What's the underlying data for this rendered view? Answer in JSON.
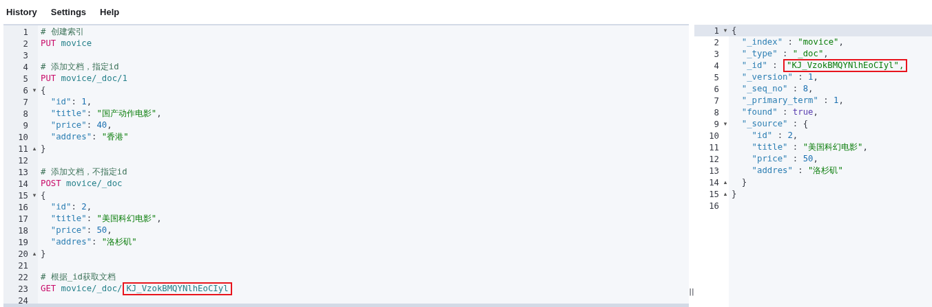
{
  "menu": [
    "History",
    "Settings",
    "Help"
  ],
  "request_editor": {
    "lines": [
      {
        "number": "1",
        "tokens": [
          {
            "text": "# 创建索引",
            "kind": "comment"
          }
        ]
      },
      {
        "number": "2",
        "tokens": [
          {
            "text": "PUT",
            "kind": "method"
          },
          {
            "text": " movice",
            "kind": "path"
          }
        ]
      },
      {
        "number": "3"
      },
      {
        "number": "4",
        "tokens": [
          {
            "text": "# 添加文档，指定id",
            "kind": "comment"
          }
        ]
      },
      {
        "number": "5",
        "tokens": [
          {
            "text": "PUT",
            "kind": "method"
          },
          {
            "text": " movice/_doc/1",
            "kind": "path"
          }
        ]
      },
      {
        "number": "6",
        "fold_marker": "▾",
        "tokens": [
          {
            "text": "{",
            "kind": "punct"
          }
        ]
      },
      {
        "number": "7",
        "tokens": [
          {
            "text": "  \"id\"",
            "kind": "key"
          },
          {
            "text": ": ",
            "kind": "punct"
          },
          {
            "text": "1",
            "kind": "number"
          },
          {
            "text": ",",
            "kind": "punct"
          }
        ]
      },
      {
        "number": "8",
        "tokens": [
          {
            "text": "  \"title\"",
            "kind": "key"
          },
          {
            "text": ": ",
            "kind": "punct"
          },
          {
            "text": "\"国产动作电影\"",
            "kind": "string"
          },
          {
            "text": ",",
            "kind": "punct"
          }
        ]
      },
      {
        "number": "9",
        "tokens": [
          {
            "text": "  \"price\"",
            "kind": "key"
          },
          {
            "text": ": ",
            "kind": "punct"
          },
          {
            "text": "40",
            "kind": "number"
          },
          {
            "text": ",",
            "kind": "punct"
          }
        ]
      },
      {
        "number": "10",
        "tokens": [
          {
            "text": "  \"addres\"",
            "kind": "key"
          },
          {
            "text": ": ",
            "kind": "punct"
          },
          {
            "text": "\"香港\"",
            "kind": "string"
          }
        ]
      },
      {
        "number": "11",
        "fold_marker": "▴",
        "tokens": [
          {
            "text": "}",
            "kind": "punct"
          }
        ]
      },
      {
        "number": "12"
      },
      {
        "number": "13",
        "tokens": [
          {
            "text": "# 添加文档，不指定id",
            "kind": "comment"
          }
        ]
      },
      {
        "number": "14",
        "tokens": [
          {
            "text": "POST",
            "kind": "method"
          },
          {
            "text": " movice/_doc",
            "kind": "path"
          }
        ]
      },
      {
        "number": "15",
        "fold_marker": "▾",
        "tokens": [
          {
            "text": "{",
            "kind": "punct"
          }
        ]
      },
      {
        "number": "16",
        "tokens": [
          {
            "text": "  \"id\"",
            "kind": "key"
          },
          {
            "text": ": ",
            "kind": "punct"
          },
          {
            "text": "2",
            "kind": "number"
          },
          {
            "text": ",",
            "kind": "punct"
          }
        ]
      },
      {
        "number": "17",
        "tokens": [
          {
            "text": "  \"title\"",
            "kind": "key"
          },
          {
            "text": ": ",
            "kind": "punct"
          },
          {
            "text": "\"美国科幻电影\"",
            "kind": "string"
          },
          {
            "text": ",",
            "kind": "punct"
          }
        ]
      },
      {
        "number": "18",
        "tokens": [
          {
            "text": "  \"price\"",
            "kind": "key"
          },
          {
            "text": ": ",
            "kind": "punct"
          },
          {
            "text": "50",
            "kind": "number"
          },
          {
            "text": ",",
            "kind": "punct"
          }
        ]
      },
      {
        "number": "19",
        "tokens": [
          {
            "text": "  \"addres\"",
            "kind": "key"
          },
          {
            "text": ": ",
            "kind": "punct"
          },
          {
            "text": "\"洛杉矶\"",
            "kind": "string"
          }
        ]
      },
      {
        "number": "20",
        "fold_marker": "▴",
        "tokens": [
          {
            "text": "}",
            "kind": "punct"
          }
        ]
      },
      {
        "number": "21"
      },
      {
        "number": "22",
        "tokens": [
          {
            "text": "# 根据_id获取文档",
            "kind": "comment"
          }
        ]
      },
      {
        "number": "23",
        "tokens": [
          {
            "text": "GET",
            "kind": "method"
          },
          {
            "text": " movice/_doc/",
            "kind": "path"
          },
          {
            "text": "KJ_VzokBMQYNlhEoCIyl",
            "kind": "path",
            "highlight": true
          }
        ]
      },
      {
        "number": "24"
      }
    ]
  },
  "splitter": {
    "label": "||"
  },
  "response_editor": {
    "lines": [
      {
        "number": "1",
        "fold_marker": "▾",
        "active": true,
        "tokens": [
          {
            "text": "{",
            "kind": "punct"
          }
        ]
      },
      {
        "number": "2",
        "tokens": [
          {
            "text": "  \"_index\"",
            "kind": "key"
          },
          {
            "text": " : ",
            "kind": "punct"
          },
          {
            "text": "\"movice\"",
            "kind": "string"
          },
          {
            "text": ",",
            "kind": "punct"
          }
        ]
      },
      {
        "number": "3",
        "tokens": [
          {
            "text": "  \"_type\"",
            "kind": "key"
          },
          {
            "text": " : ",
            "kind": "punct"
          },
          {
            "text": "\"_doc\"",
            "kind": "string"
          },
          {
            "text": ",",
            "kind": "punct"
          }
        ]
      },
      {
        "number": "4",
        "tokens": [
          {
            "text": "  \"_id\"",
            "kind": "key"
          },
          {
            "text": " : ",
            "kind": "punct"
          },
          {
            "text": "\"KJ_VzokBMQYNlhEoCIyl\",",
            "kind": "string",
            "highlight": true
          }
        ]
      },
      {
        "number": "5",
        "tokens": [
          {
            "text": "  \"_version\"",
            "kind": "key"
          },
          {
            "text": " : ",
            "kind": "punct"
          },
          {
            "text": "1",
            "kind": "number"
          },
          {
            "text": ",",
            "kind": "punct"
          }
        ]
      },
      {
        "number": "6",
        "tokens": [
          {
            "text": "  \"_seq_no\"",
            "kind": "key"
          },
          {
            "text": " : ",
            "kind": "punct"
          },
          {
            "text": "8",
            "kind": "number"
          },
          {
            "text": ",",
            "kind": "punct"
          }
        ]
      },
      {
        "number": "7",
        "tokens": [
          {
            "text": "  \"_primary_term\"",
            "kind": "key"
          },
          {
            "text": " : ",
            "kind": "punct"
          },
          {
            "text": "1",
            "kind": "number"
          },
          {
            "text": ",",
            "kind": "punct"
          }
        ]
      },
      {
        "number": "8",
        "tokens": [
          {
            "text": "  \"found\"",
            "kind": "key"
          },
          {
            "text": " : ",
            "kind": "punct"
          },
          {
            "text": "true",
            "kind": "bool"
          },
          {
            "text": ",",
            "kind": "punct"
          }
        ]
      },
      {
        "number": "9",
        "fold_marker": "▾",
        "tokens": [
          {
            "text": "  \"_source\"",
            "kind": "key"
          },
          {
            "text": " : {",
            "kind": "punct"
          }
        ]
      },
      {
        "number": "10",
        "tokens": [
          {
            "text": "    \"id\"",
            "kind": "key"
          },
          {
            "text": " : ",
            "kind": "punct"
          },
          {
            "text": "2",
            "kind": "number"
          },
          {
            "text": ",",
            "kind": "punct"
          }
        ]
      },
      {
        "number": "11",
        "tokens": [
          {
            "text": "    \"title\"",
            "kind": "key"
          },
          {
            "text": " : ",
            "kind": "punct"
          },
          {
            "text": "\"美国科幻电影\"",
            "kind": "string"
          },
          {
            "text": ",",
            "kind": "punct"
          }
        ]
      },
      {
        "number": "12",
        "tokens": [
          {
            "text": "    \"price\"",
            "kind": "key"
          },
          {
            "text": " : ",
            "kind": "punct"
          },
          {
            "text": "50",
            "kind": "number"
          },
          {
            "text": ",",
            "kind": "punct"
          }
        ]
      },
      {
        "number": "13",
        "tokens": [
          {
            "text": "    \"addres\"",
            "kind": "key"
          },
          {
            "text": " : ",
            "kind": "punct"
          },
          {
            "text": "\"洛杉矶\"",
            "kind": "string"
          }
        ]
      },
      {
        "number": "14",
        "fold_marker": "▴",
        "tokens": [
          {
            "text": "  }",
            "kind": "punct"
          }
        ]
      },
      {
        "number": "15",
        "fold_marker": "▴",
        "tokens": [
          {
            "text": "}",
            "kind": "punct"
          }
        ]
      },
      {
        "number": "16"
      }
    ]
  }
}
